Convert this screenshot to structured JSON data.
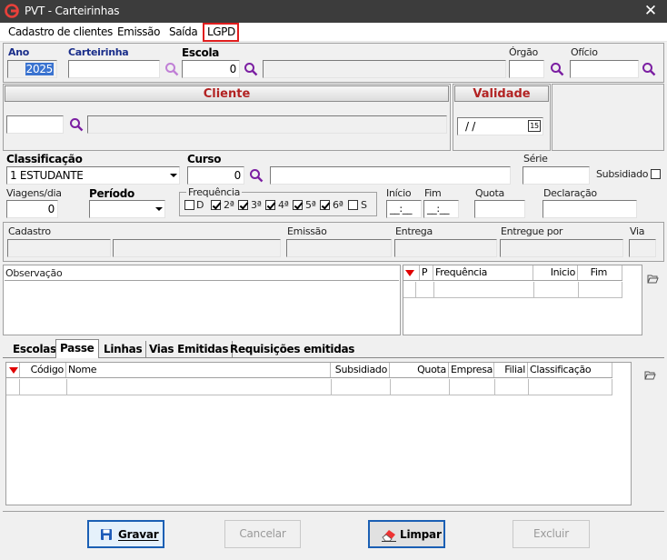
{
  "window": {
    "title": "PVT - Carteirinhas",
    "close_glyph": "✕"
  },
  "menu": [
    {
      "label": "Cadastro de clientes"
    },
    {
      "label": "Emissão"
    },
    {
      "label": "Saída"
    },
    {
      "label": "LGPD"
    }
  ],
  "top": {
    "ano_label": "Ano",
    "ano_value": "2025",
    "carteirinha_label": "Carteirinha",
    "carteirinha_value": "",
    "escola_label": "Escola",
    "escola_code": "0",
    "escola_name": "",
    "orgao_label": "Órgão",
    "orgao_value": "",
    "oficio_label": "Ofício",
    "oficio_value": ""
  },
  "cliente": {
    "header": "Cliente",
    "code": "",
    "name": ""
  },
  "validade": {
    "header": "Validade",
    "value": "/ /",
    "calendar_label": "15"
  },
  "classificacao": {
    "label": "Classificação",
    "value": "1   ESTUDANTE"
  },
  "curso": {
    "label": "Curso",
    "code": "0",
    "name": ""
  },
  "serie": {
    "label": "Série",
    "value": ""
  },
  "subsidiado": {
    "label": "Subsidiado",
    "checked": false
  },
  "viagens": {
    "label": "Viagens/dia",
    "value": "0"
  },
  "periodo": {
    "label": "Período",
    "value": ""
  },
  "frequencia": {
    "label": "Frequência",
    "days": [
      {
        "label": "D",
        "checked": false
      },
      {
        "label": "2ª",
        "checked": true
      },
      {
        "label": "3ª",
        "checked": true
      },
      {
        "label": "4ª",
        "checked": true
      },
      {
        "label": "5ª",
        "checked": true
      },
      {
        "label": "6ª",
        "checked": true
      },
      {
        "label": "S",
        "checked": false
      }
    ]
  },
  "inicio": {
    "label": "Início",
    "value": "__:__"
  },
  "fim": {
    "label": "Fim",
    "value": "__:__"
  },
  "quota": {
    "label": "Quota",
    "value": ""
  },
  "declaracao": {
    "label": "Declaração",
    "value": ""
  },
  "info": {
    "cadastro": "Cadastro",
    "emissao": "Emissão",
    "entrega": "Entrega",
    "entregue_por": "Entregue por",
    "via": "Via"
  },
  "observacao": {
    "label": "Observação",
    "value": ""
  },
  "freq_grid": {
    "columns": [
      "P",
      "Frequência",
      "Inicio",
      "Fim"
    ]
  },
  "tabs": [
    {
      "label": "Escolas"
    },
    {
      "label": "Passe"
    },
    {
      "label": "Linhas"
    },
    {
      "label": "Vias Emitidas"
    },
    {
      "label": "Requisições emitidas"
    }
  ],
  "passe_grid": {
    "columns": [
      "Código",
      "Nome",
      "Subsidiado",
      "Quota",
      "Empresa",
      "Filial",
      "Classificação"
    ]
  },
  "buttons": {
    "gravar": "Gravar",
    "cancelar": "Cancelar",
    "limpar": "Limpar",
    "excluir": "Excluir"
  },
  "colors": {
    "title_bg": "#3c3c3c",
    "accent_red": "#b22222",
    "label_blue": "#1a2e8a",
    "highlight": "#e01e1e",
    "magnifier": "#7b1fa2"
  }
}
